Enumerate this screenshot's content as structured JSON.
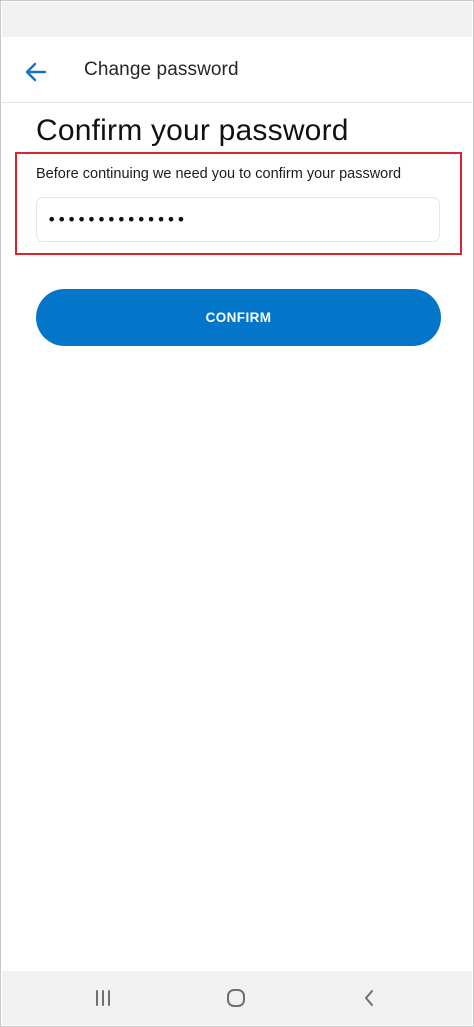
{
  "header": {
    "title": "Change password",
    "back_icon": "arrow-left-icon"
  },
  "main": {
    "heading": "Confirm your password",
    "instruction": "Before continuing we need you to confirm your password",
    "password_value": "••••••••••••••",
    "confirm_label": "CONFIRM"
  },
  "nav": {
    "recents_icon": "recent-apps-icon",
    "home_icon": "home-icon",
    "back_icon": "system-back-icon"
  },
  "colors": {
    "accent": "#0376c9",
    "highlight": "#d9252c",
    "back_arrow": "#1a73c8"
  }
}
